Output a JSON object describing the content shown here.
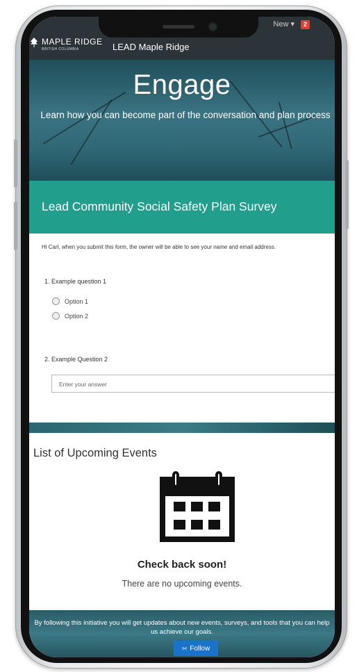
{
  "status_bar": {
    "menu_label": "New ▾",
    "badge_count": "2"
  },
  "nav": {
    "brand_name": "MAPLE RIDGE",
    "brand_sub": "BRITISH COLUMBIA",
    "site_title": "LEAD Maple Ridge"
  },
  "hero": {
    "title": "Engage",
    "subtitle": "Learn how you can become part of the conversation and plan process"
  },
  "survey": {
    "title": "Lead Community Social Safety Plan Survey",
    "notice": "Hi Carl, when you submit this form, the owner will be able to see your name and email address.",
    "question1": {
      "label": "1. Example question 1",
      "options": [
        "Option 1",
        "Option 2"
      ]
    },
    "question2": {
      "label": "2. Example Question 2",
      "placeholder": "Enter your answer"
    }
  },
  "events": {
    "title": "List of Upcoming Events",
    "heading": "Check back soon!",
    "message": "There are no upcoming events."
  },
  "footer": {
    "text": "By following this initiative you will get updates about new events, surveys, and tools that you can help us achieve our goals.",
    "follow_label": "Follow"
  },
  "colors": {
    "accent_teal": "#219e8c",
    "nav_dark": "#2d3439",
    "follow_blue": "#1a73c9"
  }
}
